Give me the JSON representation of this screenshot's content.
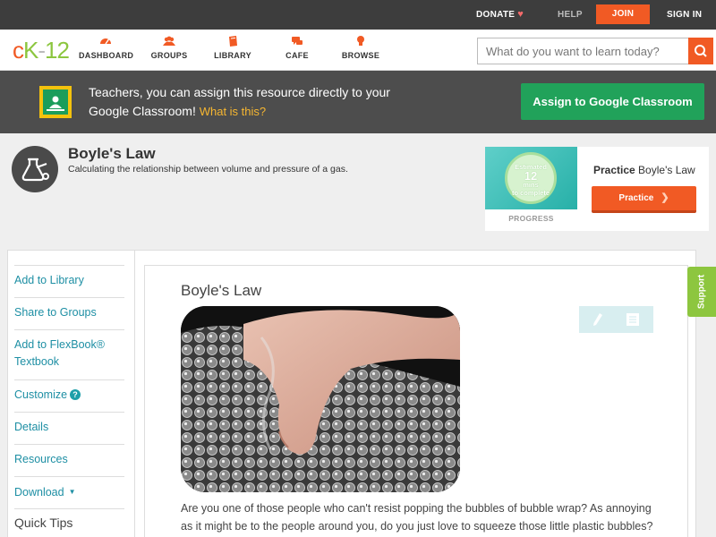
{
  "topbar": {
    "donate": "DONATE",
    "help": "HELP",
    "join": "JOIN",
    "signin": "SIGN IN"
  },
  "logo": {
    "c": "c",
    "k": "K",
    "dash": "-",
    "num": "12"
  },
  "nav": {
    "dashboard": "DASHBOARD",
    "groups": "GROUPS",
    "library": "LIBRARY",
    "cafe": "CAFE",
    "browse": "BROWSE"
  },
  "search": {
    "placeholder": "What do you want to learn today?"
  },
  "banner": {
    "text": "Teachers, you can assign this resource directly to your Google Classroom!",
    "what_link": "What is this?",
    "assign_button": "Assign to Google Classroom"
  },
  "concept": {
    "title": "Boyle's Law",
    "subtitle": "Calculating the relationship between volume and pressure of a gas."
  },
  "practice_card": {
    "estimated": "Estimated",
    "minutes": "12",
    "mins_label": "mins",
    "to_complete": "to complete",
    "progress": "PROGRESS",
    "title_bold": "Practice",
    "title_rest": "Boyle's Law",
    "button": "Practice"
  },
  "sidebar": {
    "items": [
      {
        "label": "Add to Library"
      },
      {
        "label": "Share to Groups"
      },
      {
        "label": "Add to FlexBook® Textbook"
      },
      {
        "label": "Customize"
      },
      {
        "label": "Details"
      },
      {
        "label": "Resources"
      },
      {
        "label": "Download"
      }
    ],
    "quick_tips": "Quick Tips"
  },
  "article": {
    "title": "Boyle's Law",
    "paragraph": "Are you one of those people who can't resist popping the bubbles of bubble wrap? As annoying as it might be to the people around you, do you just love to squeeze those little plastic bubbles?"
  },
  "support": "Support",
  "colors": {
    "accent": "#f15a24",
    "green": "#21a25a",
    "link": "#1e8fa4",
    "support": "#8dc63f"
  }
}
